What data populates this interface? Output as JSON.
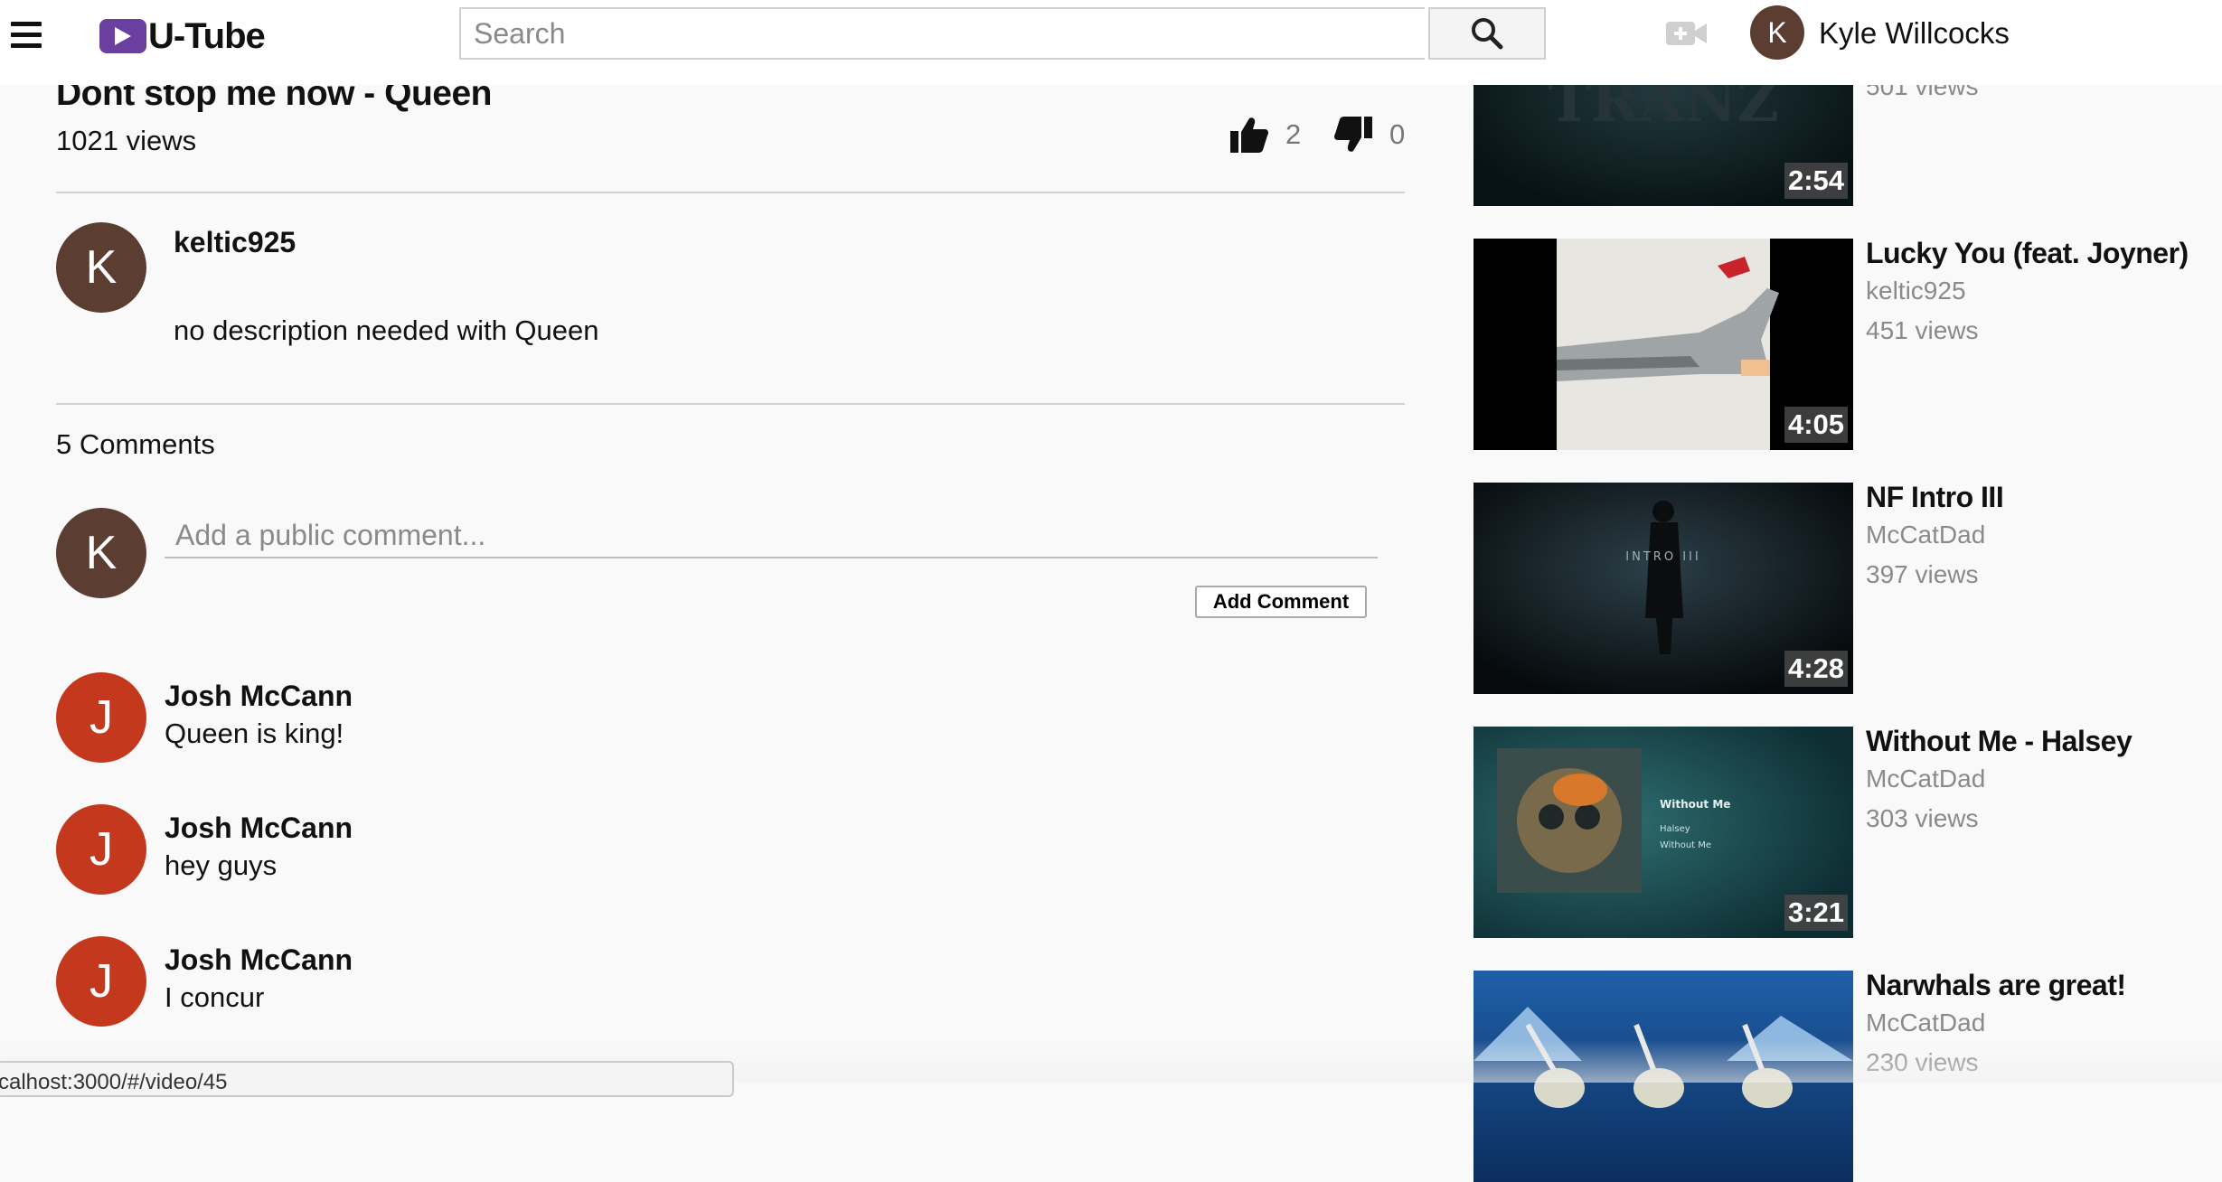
{
  "header": {
    "logo_text": "U-Tube",
    "search_placeholder": "Search",
    "user_initial": "K",
    "user_name": "Kyle Willcocks"
  },
  "video": {
    "title": "Dont stop me now - Queen",
    "views": "1021 views",
    "likes": "2",
    "dislikes": "0",
    "uploader_initial": "K",
    "uploader": "keltic925",
    "description": "no description needed with Queen"
  },
  "comments": {
    "count_label": "5 Comments",
    "input_placeholder": "Add a public comment...",
    "user_initial": "K",
    "add_button": "Add Comment",
    "items": [
      {
        "initial": "J",
        "author": "Josh McCann",
        "text": "Queen is king!"
      },
      {
        "initial": "J",
        "author": "Josh McCann",
        "text": "hey guys"
      },
      {
        "initial": "J",
        "author": "Josh McCann",
        "text": "I concur"
      }
    ]
  },
  "recommended": [
    {
      "title": "",
      "channel": "",
      "views": "501 views",
      "duration": "2:54",
      "thumb_text": "TRANZ"
    },
    {
      "title": "Lucky You (feat. Joyner)",
      "channel": "keltic925",
      "views": "451 views",
      "duration": "4:05"
    },
    {
      "title": "NF Intro III",
      "channel": "McCatDad",
      "views": "397 views",
      "duration": "4:28",
      "thumb_text": "INTRO III"
    },
    {
      "title": "Without Me - Halsey",
      "channel": "McCatDad",
      "views": "303 views",
      "duration": "3:21",
      "thumb_text": "Without Me",
      "thumb_sub1": "Halsey",
      "thumb_sub2": "Without Me"
    },
    {
      "title": "Narwhals are great!",
      "channel": "McCatDad",
      "views": "230 views",
      "duration": ""
    }
  ],
  "status_bar_url": "calhost:3000/#/video/45",
  "colors": {
    "logo_purple": "#6a3fa0",
    "avatar_brown": "#5c3d32",
    "avatar_red": "#c4391d"
  }
}
